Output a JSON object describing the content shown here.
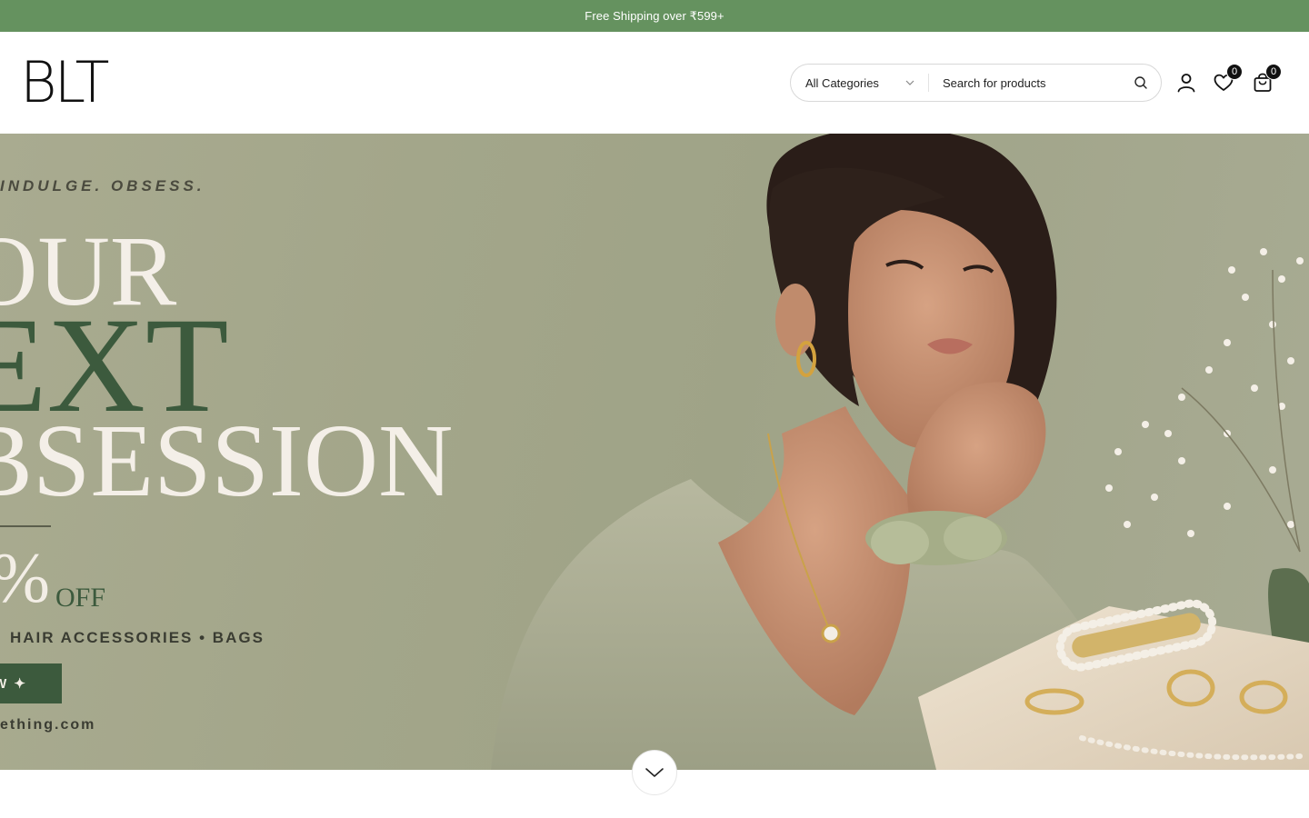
{
  "announcement": {
    "text": "Free Shipping over ₹599+"
  },
  "brand": {
    "logo_text": "BLT"
  },
  "search": {
    "category_selected": "All Categories",
    "placeholder": "Search for products"
  },
  "header_icons": {
    "wishlist_count": "0",
    "cart_count": "0"
  },
  "hero": {
    "tagline": "INDULGE. OBSESS.",
    "line1": "OUR",
    "line2": "EXT",
    "line3": "BSESSION",
    "discount": "%",
    "discount_suffix": "OFF",
    "categories": "HAIR ACCESSORIES  •  BAGS",
    "button_label": "W ✦",
    "website": "ething.com"
  },
  "colors": {
    "announcement_bg": "#65925f",
    "accent_green": "#3c5a3d",
    "hero_bg": "#a3a68a"
  }
}
